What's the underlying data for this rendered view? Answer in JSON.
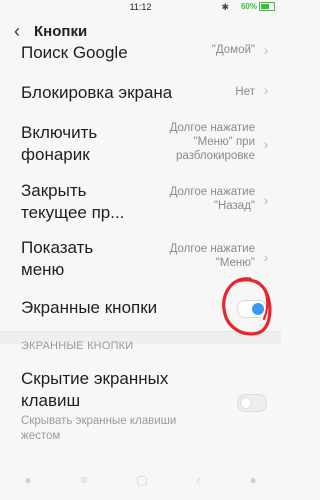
{
  "status": {
    "time": "11:12",
    "bluetooth": "✱",
    "battery": "60%",
    "battery_color": "#36c13a"
  },
  "header": {
    "title": "Кнопки"
  },
  "rows": [
    {
      "label": "Поиск Google",
      "value": "\"Домой\""
    },
    {
      "label": "Блокировка экрана",
      "value": "Нет"
    },
    {
      "label_l1": "Включить",
      "label_l2": "фонарик",
      "value_l1": "Долгое нажатие",
      "value_l2": "\"Меню\" при",
      "value_l3": "разблокировке"
    },
    {
      "label_l1": "Закрыть",
      "label_l2": "текущее пр...",
      "value_l1": "Долгое нажатие",
      "value_l2": "\"Назад\""
    },
    {
      "label_l1": "Показать",
      "label_l2": "меню",
      "value_l1": "Долгое нажатие",
      "value_l2": "\"Меню\""
    },
    {
      "label": "Экранные кнопки",
      "toggle_on": true
    }
  ],
  "section": {
    "heading": "ЭКРАННЫЕ КНОПКИ"
  },
  "hide_keys": {
    "label_l1": "Скрытие экранных",
    "label_l2": "клавиш",
    "desc_l1": "Скрывать экранные клавиши",
    "desc_l2": "жестом",
    "toggle_on": false
  },
  "accent_color": "#3b96f5",
  "annotation_color": "#e8252d"
}
